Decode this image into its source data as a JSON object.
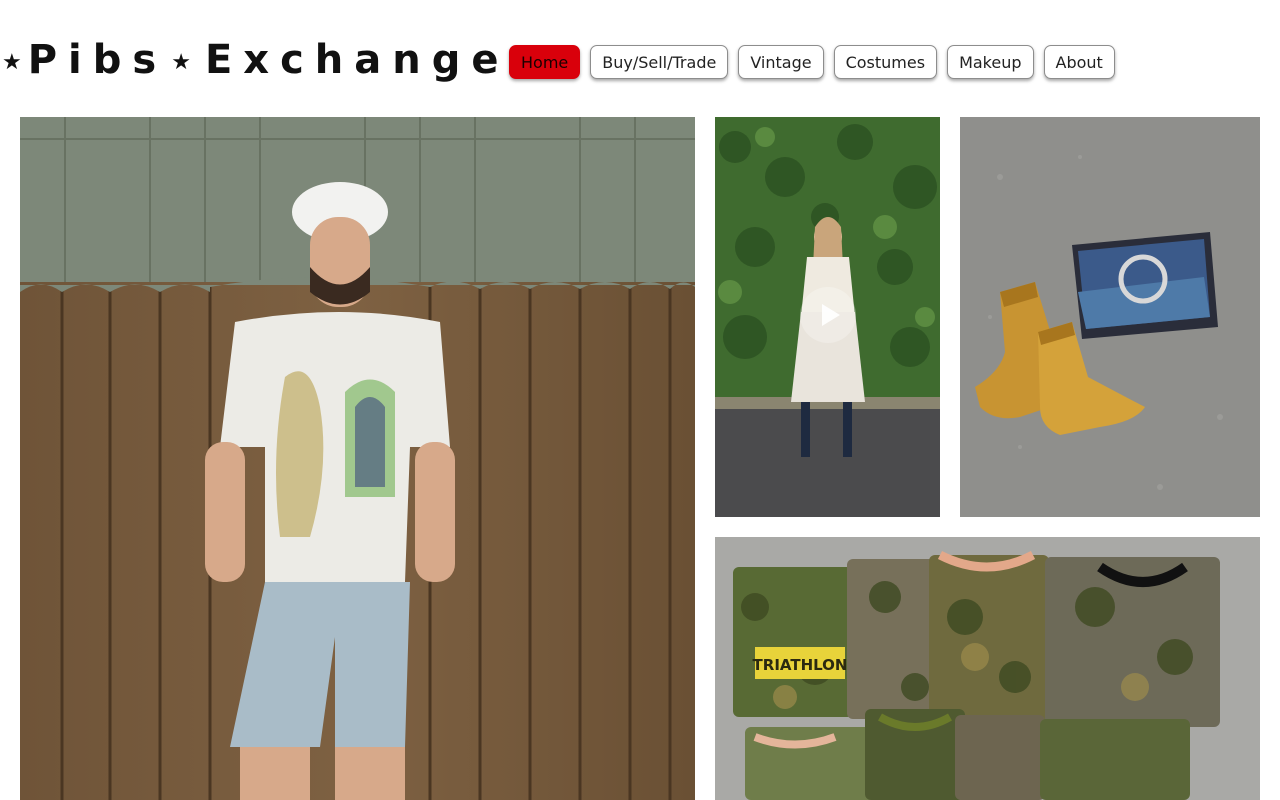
{
  "site": {
    "logo_word_1": "Pibs",
    "logo_word_2": "Exchange"
  },
  "nav": {
    "items": [
      {
        "label": "Home",
        "active": true
      },
      {
        "label": "Buy/Sell/Trade",
        "active": false
      },
      {
        "label": "Vintage",
        "active": false
      },
      {
        "label": "Costumes",
        "active": false
      },
      {
        "label": "Makeup",
        "active": false
      },
      {
        "label": "About",
        "active": false
      }
    ],
    "active_color": "#d9000b"
  },
  "gallery": {
    "items": [
      {
        "kind": "photo",
        "subject": "man in embroidered shirt against wooden fence"
      },
      {
        "kind": "video",
        "subject": "woman in white dress in front of ivy wall",
        "icon": "play-icon"
      },
      {
        "kind": "photo",
        "subject": "yellow cowboy boots with boot box"
      },
      {
        "kind": "photo",
        "subject": "stack of camo t-shirts"
      }
    ],
    "tshirt_text": "TRIATHLON"
  }
}
